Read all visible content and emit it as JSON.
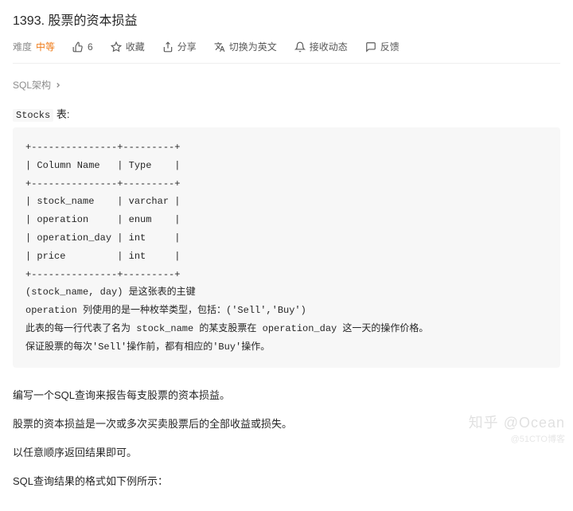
{
  "title": "1393. 股票的资本损益",
  "actions": {
    "difficulty_label": "难度",
    "difficulty_value": "中等",
    "like_count": "6",
    "favorite": "收藏",
    "share": "分享",
    "switch_lang": "切换为英文",
    "subscribe": "接收动态",
    "feedback": "反馈"
  },
  "schema_link": "SQL架构",
  "table_name": "Stocks",
  "table_suffix": " 表:",
  "code_block": "+---------------+---------+\n| Column Name   | Type    |\n+---------------+---------+\n| stock_name    | varchar |\n| operation     | enum    |\n| operation_day | int     |\n| price         | int     |\n+---------------+---------+\n(stock_name, day) 是这张表的主键\noperation 列使用的是一种枚举类型，包括：('Sell','Buy')\n此表的每一行代表了名为 stock_name 的某支股票在 operation_day 这一天的操作价格。\n保证股票的每次'Sell'操作前，都有相应的'Buy'操作。",
  "paragraphs": {
    "p1": "编写一个SQL查询来报告每支股票的资本损益。",
    "p2": "股票的资本损益是一次或多次买卖股票后的全部收益或损失。",
    "p3": "以任意顺序返回结果即可。",
    "p4": "SQL查询结果的格式如下例所示："
  },
  "watermark": "知乎 @Ocean",
  "watermark_sub": "@51CTO博客"
}
